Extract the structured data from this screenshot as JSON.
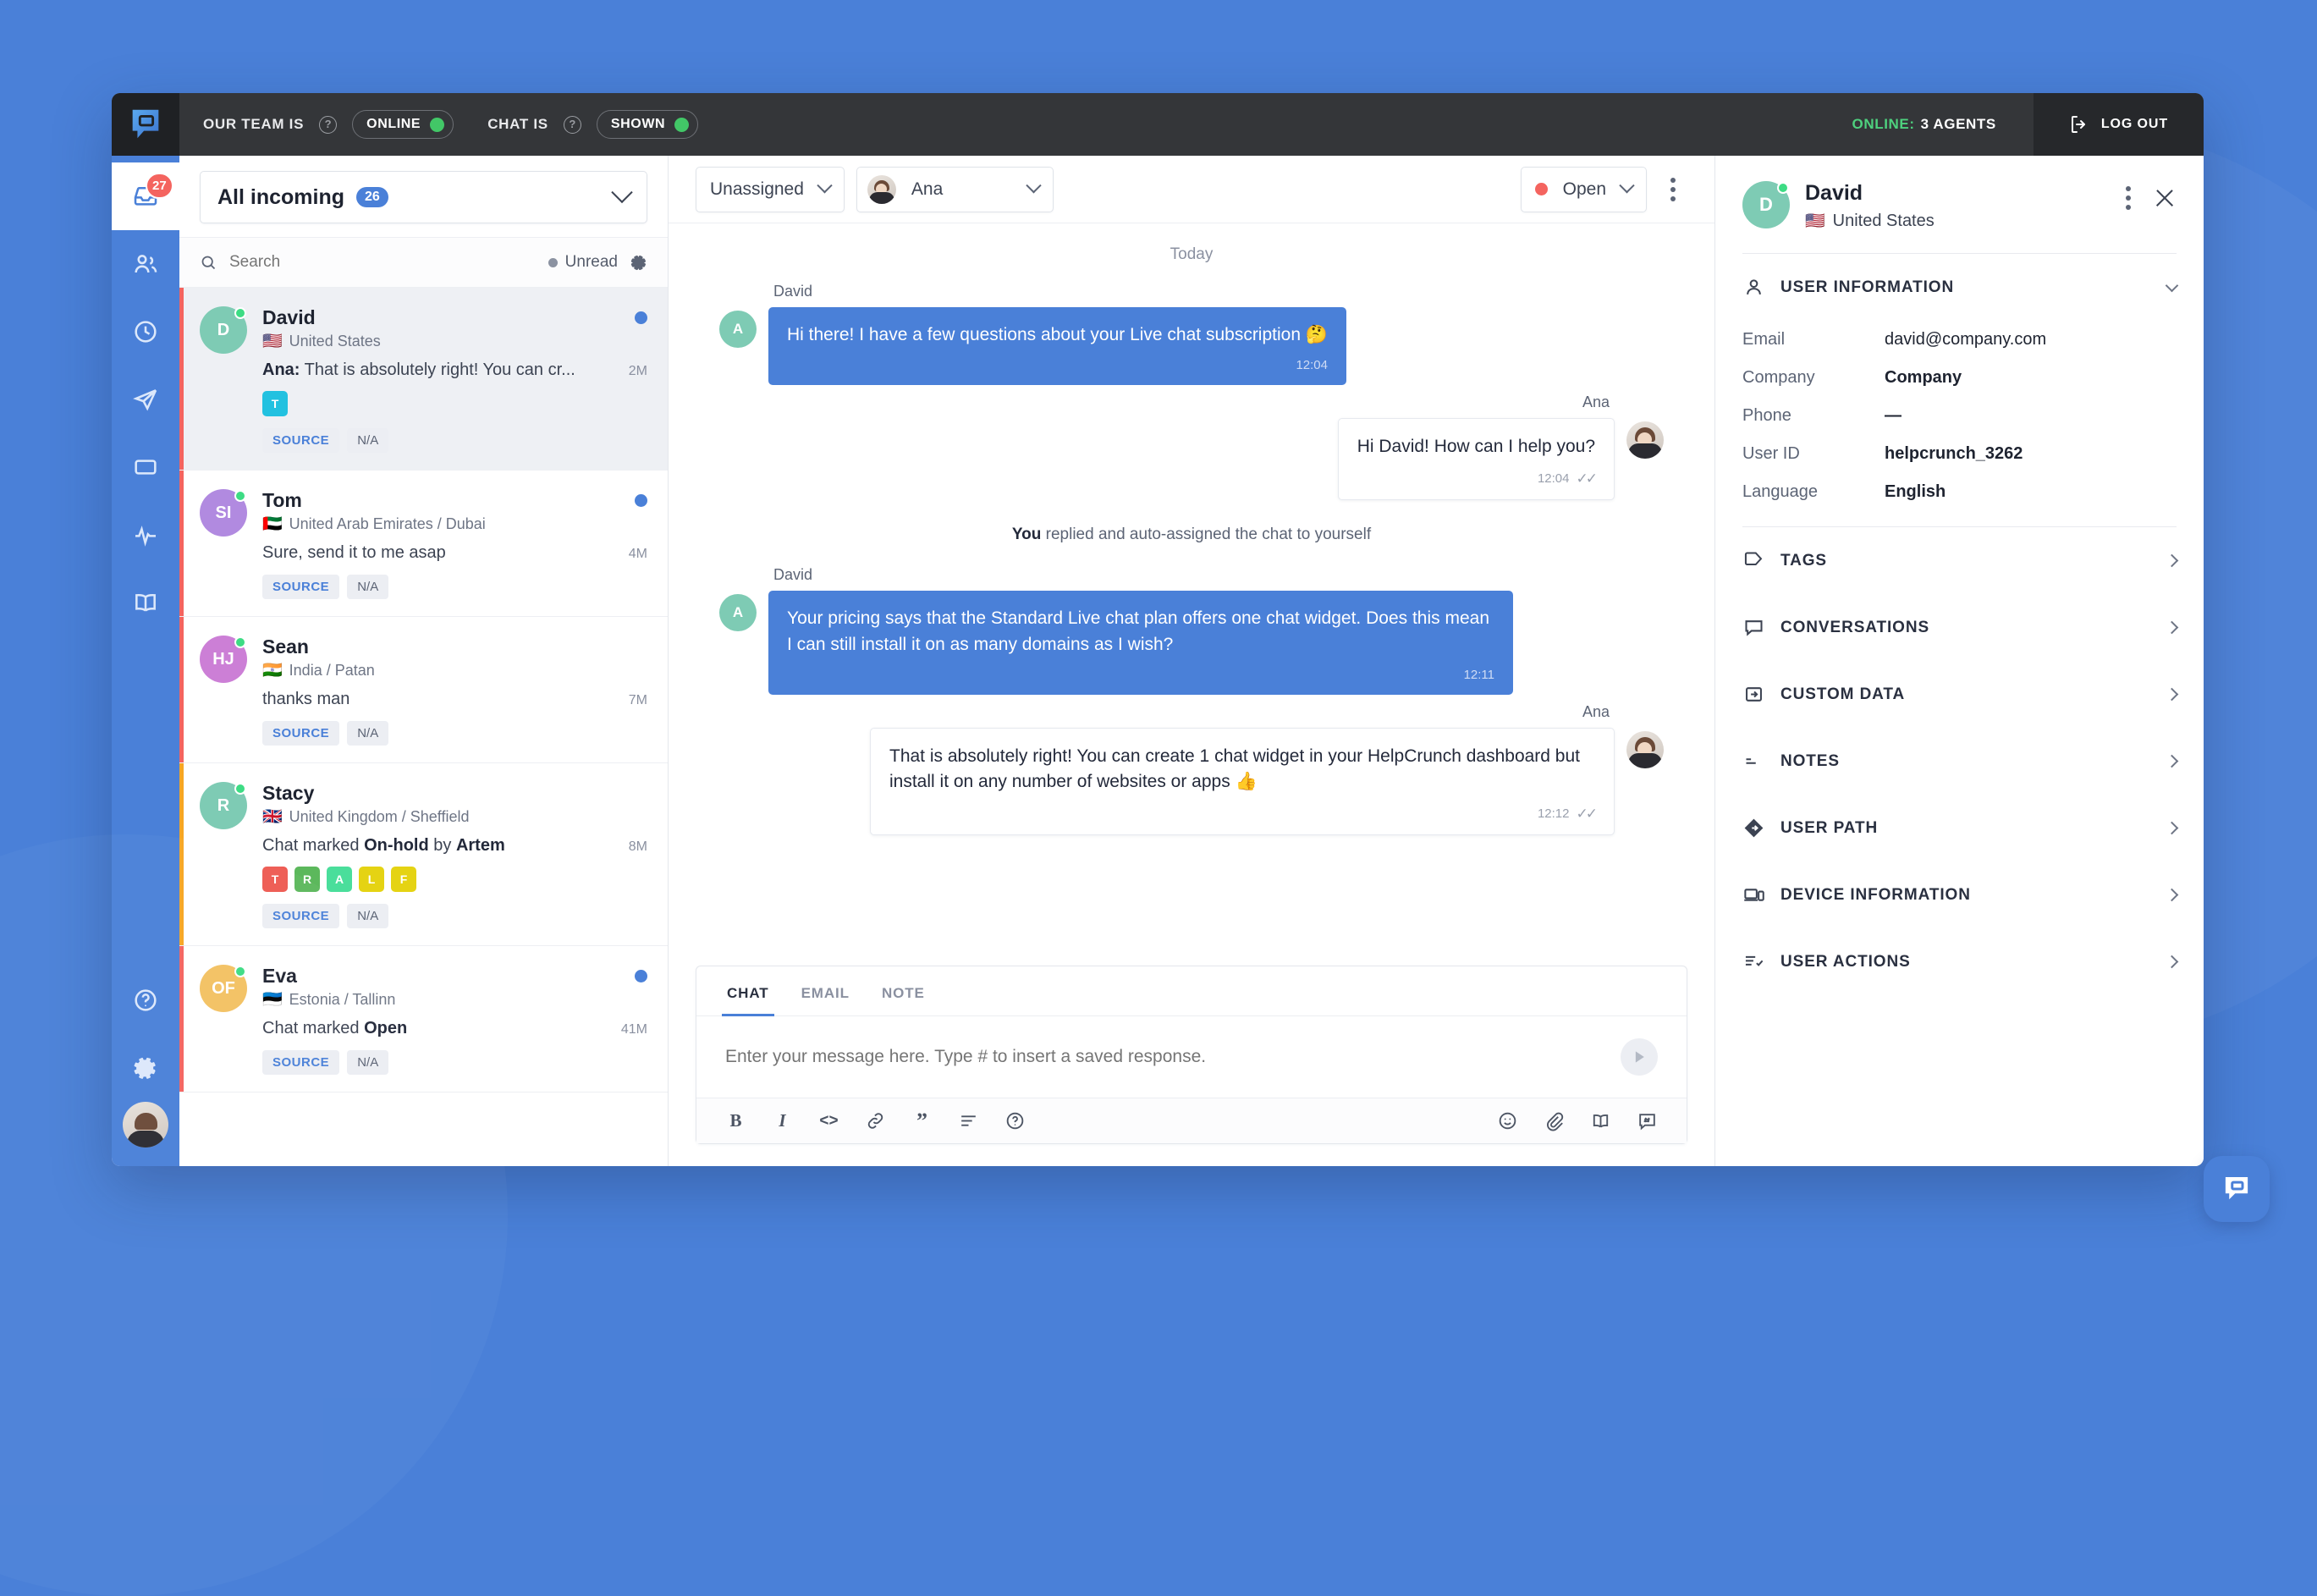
{
  "topbar": {
    "team_label": "OUR TEAM IS",
    "team_status": "ONLINE",
    "chat_label": "CHAT IS",
    "chat_status": "SHOWN",
    "online_prefix": "ONLINE:",
    "online_count": "3 AGENTS",
    "logout": "LOG OUT",
    "help_glyph": "?"
  },
  "rail": {
    "items": [
      {
        "name": "inbox",
        "badge": "27",
        "active": true
      },
      {
        "name": "contacts",
        "badge": "",
        "active": false
      },
      {
        "name": "history",
        "badge": "",
        "active": false
      },
      {
        "name": "campaigns",
        "badge": "",
        "active": false
      },
      {
        "name": "popups",
        "badge": "",
        "active": false
      },
      {
        "name": "analytics",
        "badge": "",
        "active": false
      },
      {
        "name": "knowledge-base",
        "badge": "",
        "active": false
      }
    ],
    "help": "?",
    "settings": "gear"
  },
  "conversation_list": {
    "filter_label": "All incoming",
    "filter_count": "26",
    "search_placeholder": "Search",
    "unread_label": "Unread",
    "source_chip": "SOURCE",
    "source_value": "N/A",
    "items": [
      {
        "name": "David",
        "initials": "D",
        "avatar_color": "#7ecbb4",
        "flag": "🇺🇸",
        "location": "United States",
        "preview_prefix": "Ana:",
        "preview": "That is absolutely right! You can cr...",
        "time": "2M",
        "unread": true,
        "bar": "red",
        "selected": true,
        "tags": [
          {
            "letter": "T",
            "color": "#22c1e0"
          }
        ]
      },
      {
        "name": "Tom",
        "initials": "SI",
        "avatar_color": "#b18ae0",
        "flag": "🇦🇪",
        "location": "United Arab Emirates / Dubai",
        "preview_prefix": "",
        "preview": "Sure, send it to me asap",
        "time": "4M",
        "unread": true,
        "bar": "red",
        "selected": false,
        "tags": []
      },
      {
        "name": "Sean",
        "initials": "HJ",
        "avatar_color": "#cc7fd6",
        "flag": "🇮🇳",
        "location": "India / Patan",
        "preview_prefix": "",
        "preview": "thanks man",
        "time": "7M",
        "unread": false,
        "bar": "red",
        "selected": false,
        "tags": []
      },
      {
        "name": "Stacy",
        "initials": "R",
        "avatar_color": "#7ecbb4",
        "flag": "🇬🇧",
        "location": "United Kingdom / Sheffield",
        "preview_prefix": "",
        "preview": "Chat marked On-hold by Artem",
        "time": "8M",
        "unread": false,
        "bar": "orange",
        "selected": false,
        "tags": [
          {
            "letter": "T",
            "color": "#ee5a52"
          },
          {
            "letter": "R",
            "color": "#5cb85c"
          },
          {
            "letter": "A",
            "color": "#4ade9b"
          },
          {
            "letter": "L",
            "color": "#e5d313"
          },
          {
            "letter": "F",
            "color": "#e5d313"
          }
        ]
      },
      {
        "name": "Eva",
        "initials": "OF",
        "avatar_color": "#f3c263",
        "flag": "🇪🇪",
        "location": "Estonia / Tallinn",
        "preview_prefix": "",
        "preview": "Chat marked Open",
        "time": "41M",
        "unread": true,
        "bar": "red",
        "selected": false,
        "tags": []
      }
    ]
  },
  "chat_header": {
    "assignee": "Unassigned",
    "agent": "Ana",
    "status": "Open"
  },
  "thread": {
    "day_separator": "Today",
    "system_line_prefix": "You",
    "system_line_rest": " replied and auto-assigned the chat to yourself",
    "messages": [
      {
        "author": "David",
        "side": "in",
        "initials": "A",
        "avatar_color": "#7ecbb4",
        "text": "Hi there! I have a few questions about your Live chat subscription 🤔",
        "time": "12:04",
        "read": false
      },
      {
        "author": "Ana",
        "side": "out",
        "initials": "",
        "avatar_color": "",
        "text": "Hi David! How can I help you?",
        "time": "12:04",
        "read": true
      },
      {
        "author": "David",
        "side": "in",
        "initials": "A",
        "avatar_color": "#7ecbb4",
        "text": "Your pricing says that the Standard Live chat plan offers one chat widget. Does this mean I can still install it on as many domains as I wish?",
        "time": "12:11",
        "read": false
      },
      {
        "author": "Ana",
        "side": "out",
        "initials": "",
        "avatar_color": "",
        "text": "That is absolutely right! You can create 1 chat widget in your HelpCrunch dashboard but install it on any number of websites or apps 👍",
        "time": "12:12",
        "read": true
      }
    ],
    "tick_glyph": "✓✓"
  },
  "composer": {
    "tabs": [
      {
        "label": "CHAT",
        "active": true
      },
      {
        "label": "EMAIL",
        "active": false
      },
      {
        "label": "NOTE",
        "active": false
      }
    ],
    "placeholder": "Enter your message here. Type # to insert a saved response.",
    "value": "",
    "tools": [
      {
        "name": "bold",
        "glyph": "B"
      },
      {
        "name": "italic",
        "glyph": "I"
      },
      {
        "name": "code",
        "glyph": "<>"
      },
      {
        "name": "link",
        "glyph": ""
      },
      {
        "name": "quote",
        "glyph": "”"
      },
      {
        "name": "list",
        "glyph": ""
      },
      {
        "name": "help",
        "glyph": "?"
      }
    ],
    "right_tools": [
      {
        "name": "emoji"
      },
      {
        "name": "attachment"
      },
      {
        "name": "knowledge-base"
      },
      {
        "name": "saved-response"
      }
    ]
  },
  "side_panel": {
    "name": "David",
    "initials": "D",
    "avatar_color": "#7ecbb4",
    "flag": "🇺🇸",
    "location": "United States",
    "user_information_title": "USER INFORMATION",
    "fields": [
      {
        "key": "Email",
        "value": "david@company.com"
      },
      {
        "key": "Company",
        "value": "Company"
      },
      {
        "key": "Phone",
        "value": "—"
      },
      {
        "key": "User ID",
        "value": "helpcrunch_3262"
      },
      {
        "key": "Language",
        "value": "English"
      }
    ],
    "sections": [
      {
        "label": "TAGS",
        "icon": "tag"
      },
      {
        "label": "CONVERSATIONS",
        "icon": "chat"
      },
      {
        "label": "CUSTOM DATA",
        "icon": "custom-data"
      },
      {
        "label": "NOTES",
        "icon": "notes"
      },
      {
        "label": "USER PATH",
        "icon": "user-path"
      },
      {
        "label": "DEVICE INFORMATION",
        "icon": "device"
      },
      {
        "label": "USER ACTIONS",
        "icon": "user-actions"
      }
    ]
  },
  "colors": {
    "brand": "#4a80d8",
    "accent_green": "#42c767",
    "accent_red": "#f4645f",
    "accent_orange": "#f6a623",
    "topbar_bg": "#343639"
  }
}
